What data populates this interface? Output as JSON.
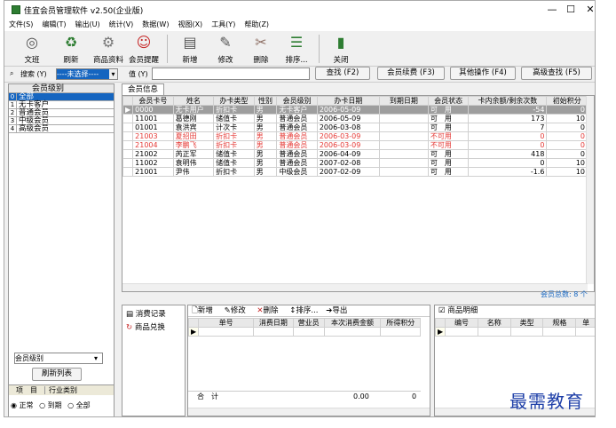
{
  "window": {
    "title": "佳宜会员管理软件 v2.50(企业版)"
  },
  "menu": [
    "文件(S)",
    "编辑(T)",
    "输出(U)",
    "统计(V)",
    "数据(W)",
    "视图(X)",
    "工具(Y)",
    "帮助(Z)"
  ],
  "toolbar": [
    "文班",
    "刷新",
    "商品资料",
    "会员提醒",
    "新增",
    "修改",
    "删除",
    "排序...",
    "关闭"
  ],
  "search": {
    "label": "搜索 (Y)",
    "field": "----未选择----",
    "value_label": "值 (Y)",
    "find": "查找 (F2)",
    "renew": "会员续费 (F3)",
    "other": "其他操作 (F4)",
    "advanced": "高级查找 (F5)"
  },
  "left": {
    "header": "会员级别",
    "items": [
      {
        "k": "0",
        "v": "全部"
      },
      {
        "k": "1",
        "v": "无卡客户"
      },
      {
        "k": "2",
        "v": "普通会员"
      },
      {
        "k": "3",
        "v": "中级会员"
      },
      {
        "k": "4",
        "v": "高级会员"
      }
    ],
    "filter": "会员级别",
    "refresh": "刷新列表",
    "tab1": "项　目",
    "tab2": "行业类别",
    "r1": "正常",
    "r2": "到期",
    "r3": "全部"
  },
  "main": {
    "tab": "会员信息",
    "columns": [
      "会员卡号",
      "姓名",
      "办卡类型",
      "性别",
      "会员级别",
      "办卡日期",
      "到期日期",
      "会员状态",
      "卡内余额/剩余次数",
      "初始积分"
    ],
    "rows": [
      [
        "0000",
        "无卡用户",
        "折扣卡",
        "男",
        "无卡客户",
        "2006-05-09",
        "",
        "可　用",
        "-54",
        "0"
      ],
      [
        "11001",
        "葛德刚",
        "储值卡",
        "男",
        "普通会员",
        "2006-05-09",
        "",
        "可　用",
        "173",
        "10"
      ],
      [
        "01001",
        "袁洪宾",
        "计次卡",
        "男",
        "普通会员",
        "2006-03-08",
        "",
        "可　用",
        "7",
        "0"
      ],
      [
        "21003",
        "夏招田",
        "折扣卡",
        "男",
        "普通会员",
        "2006-03-09",
        "",
        "不可用",
        "0",
        "0"
      ],
      [
        "21004",
        "李鹏飞",
        "折扣卡",
        "男",
        "普通会员",
        "2006-03-09",
        "",
        "不可用",
        "0",
        "0"
      ],
      [
        "21002",
        "芮正军",
        "储值卡",
        "男",
        "普通会员",
        "2006-04-09",
        "",
        "可　用",
        "418",
        "0"
      ],
      [
        "11002",
        "袁明伟",
        "储值卡",
        "男",
        "普通会员",
        "2007-02-08",
        "",
        "可　用",
        "0",
        "10"
      ],
      [
        "21001",
        "尹伟",
        "折扣卡",
        "男",
        "中级会员",
        "2007-02-09",
        "",
        "可　用",
        "-1.6",
        "10"
      ]
    ],
    "total": "会员总数: 8 个"
  },
  "lower": {
    "tab1": "消费记录",
    "tab2": "商品兑换",
    "add": "新增",
    "edit": "修改",
    "del": "删除",
    "sort": "排序...",
    "export": "导出",
    "cols": [
      "单号",
      "消费日期",
      "营业员",
      "本次消费金额",
      "所得积分"
    ],
    "sum": "合　计",
    "sum_amount": "0.00",
    "sum_points": "0",
    "detail": "商品明细",
    "dcols": [
      "编号",
      "名称",
      "类型",
      "规格",
      "单"
    ]
  },
  "watermark": "最需教育"
}
